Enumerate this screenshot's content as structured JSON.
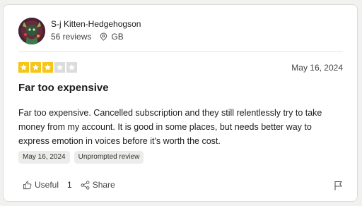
{
  "reviewer": {
    "name": "S-j Kitten-Hedgehogson",
    "reviews_count": "56 reviews",
    "location": "GB",
    "avatar_icon": "reviewer-avatar"
  },
  "rating": {
    "value": 3,
    "max": 5,
    "filled_color": "#f5c517",
    "empty_color": "#dcdcdc"
  },
  "review": {
    "date": "May 16, 2024",
    "title": "Far too expensive",
    "body": "Far too expensive. Cancelled subscription and they still relentlessly try to take money from my account. It is good in some places, but needs better way to express emotion in voices before it's worth the cost.",
    "chips": [
      "May 16, 2024",
      "Unprompted review"
    ]
  },
  "actions": {
    "useful_label": "Useful",
    "useful_count": "1",
    "share_label": "Share",
    "icons": [
      "thumbs-up-icon",
      "share-icon",
      "flag-icon"
    ]
  }
}
